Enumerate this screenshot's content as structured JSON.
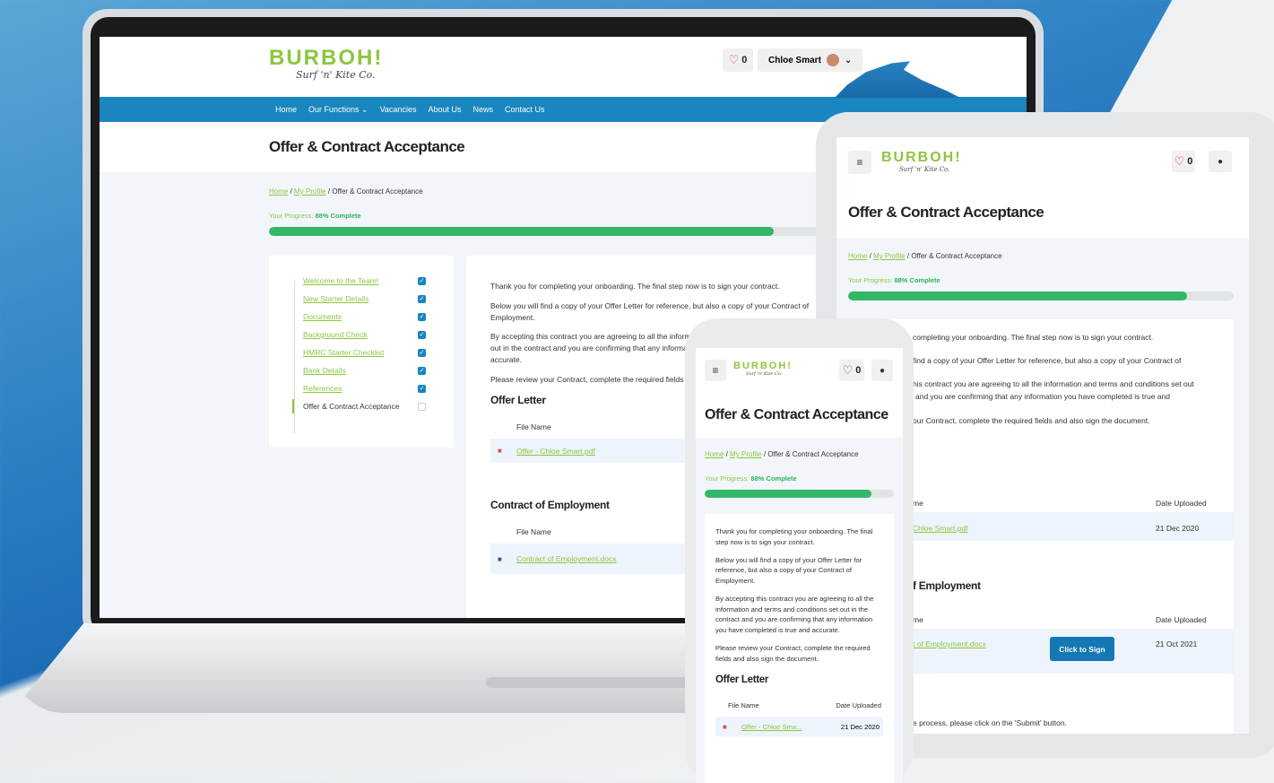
{
  "brand": {
    "logo_main": "BURBOH!",
    "logo_sub": "Surf 'n' Kite Co."
  },
  "header": {
    "favourites_count": "0",
    "user_name": "Chloe Smart"
  },
  "nav": [
    "Home",
    "Our Functions ⌄",
    "Vacancies",
    "About Us",
    "News",
    "Contact Us"
  ],
  "page": {
    "title": "Offer & Contract Acceptance",
    "breadcrumb": {
      "home": "Home",
      "separator": "/",
      "profile": "My Profile",
      "current": "Offer & Contract Acceptance"
    },
    "progress": {
      "label": "Your Progress:",
      "value_text": "88% Complete",
      "percent": 88
    }
  },
  "steps": [
    {
      "label": "Welcome to the Team!",
      "done": true
    },
    {
      "label": "New Starter Details",
      "done": true
    },
    {
      "label": "Documents",
      "done": true
    },
    {
      "label": "Background Check",
      "done": true
    },
    {
      "label": "HMRC Starter Checklist",
      "done": true
    },
    {
      "label": "Bank Details",
      "done": true
    },
    {
      "label": "References",
      "done": true
    },
    {
      "label": "Offer & Contract Acceptance",
      "done": false
    }
  ],
  "content": {
    "p1": "Thank you for completing your onboarding. The final step now is to sign your contract.",
    "p2": "Below you will find a copy of your Offer Letter for reference, but also a copy of your Contract of Employment.",
    "p3": "By accepting this contract you are agreeing to all the information and terms and conditions set out in the contract and you are confirming that any information you have completed is true and accurate.",
    "p4": "Please review your Contract, complete the required fields and also sign the document.",
    "offer_heading": "Offer Letter",
    "contract_heading": "Contract of Employment",
    "col_file": "File Name",
    "col_date": "Date Uploaded",
    "offer_file": "Offer - Chloe Smart.pdf",
    "offer_file_short": "Offer - Chloe Sma...",
    "offer_date": "21 Dec 2020",
    "contract_file": "Contract of Employment.docx",
    "contract_date": "21 Oct 2021",
    "sign_button": "Click to Sign",
    "submit_hint": "e process, please click on the 'Submit' button."
  },
  "tablet_fragments": {
    "p1": "completing your onboarding. The final step now is to sign your contract.",
    "p2": "find a copy of your Offer Letter for reference, but also a copy of your Contract of",
    "p3a": "his contract you are agreeing to all the information and terms and conditions set out",
    "p3b": "and you are confirming that any information you have completed is true and",
    "p4": "our Contract, complete the required fields and also sign the document.",
    "col_file": "me",
    "offer_file": "Chloe Smart.pdf",
    "contract_heading": "f Employment",
    "contract_file": "t of Employment.docx"
  },
  "colors": {
    "brand_green": "#8cc63f",
    "nav_blue": "#1986bf",
    "progress_green": "#33b667",
    "button_blue": "#1478b5"
  },
  "icons": {
    "favourite": "heart-icon",
    "menu": "hamburger-icon",
    "user": "user-icon",
    "pdf": "pdf-file-icon",
    "doc": "word-file-icon",
    "check": "checkbox-checked-icon"
  }
}
